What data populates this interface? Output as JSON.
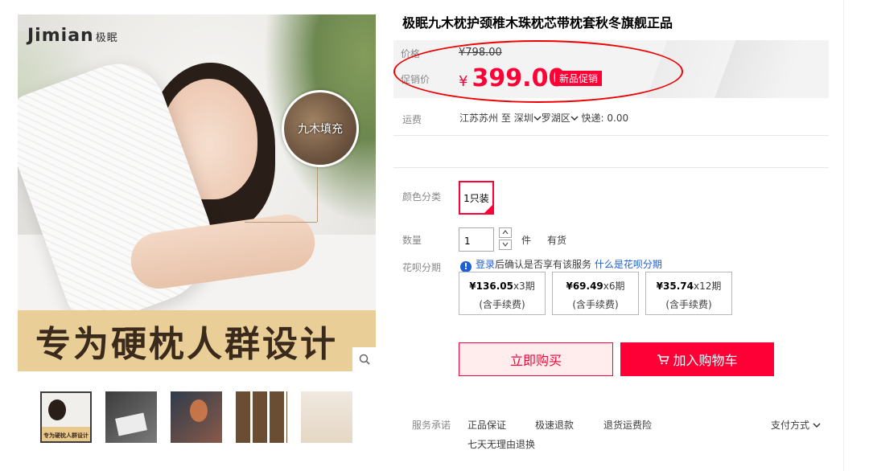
{
  "gallery": {
    "brand": "Jimian",
    "brand_cn": "极眠",
    "badge_text": "九木填充",
    "banner_text": "专为硬枕人群设计",
    "thumb_label": "专为硬枕人群设计"
  },
  "product": {
    "title": "极眠九木枕护颈椎木珠枕芯带枕套秋冬旗舰正品",
    "price_label": "价格",
    "original_price": "¥798.00",
    "promo_label": "促销价",
    "currency": "¥",
    "promo_price": "399.00",
    "promo_tag": "新品促销"
  },
  "shipping": {
    "label": "运费",
    "from": "江苏苏州",
    "to_word": "至",
    "city": "深圳",
    "district": "罗湖区",
    "express": "快递: 0.00"
  },
  "sku": {
    "label": "颜色分类",
    "selected": "1只装"
  },
  "quantity": {
    "label": "数量",
    "value": "1",
    "unit": "件",
    "stock": "有货"
  },
  "huabei": {
    "label": "花呗分期",
    "login_link": "登录",
    "info_text": "后确认是否享有该服务",
    "what_link": "什么是花呗分期",
    "options": [
      {
        "amount": "¥136.05",
        "periods": "x3期",
        "fee": "(含手续费)"
      },
      {
        "amount": "¥69.49",
        "periods": "x6期",
        "fee": "(含手续费)"
      },
      {
        "amount": "¥35.74",
        "periods": "x12期",
        "fee": "(含手续费)"
      }
    ]
  },
  "actions": {
    "buy_now": "立即购买",
    "add_to_cart": "加入购物车"
  },
  "service": {
    "label": "服务承诺",
    "items": [
      "正品保证",
      "极速退款",
      "退货运费险",
      "七天无理由退换"
    ],
    "payment": "支付方式"
  },
  "colors": {
    "accent": "#ff0036",
    "banner": "#e9ce98"
  }
}
